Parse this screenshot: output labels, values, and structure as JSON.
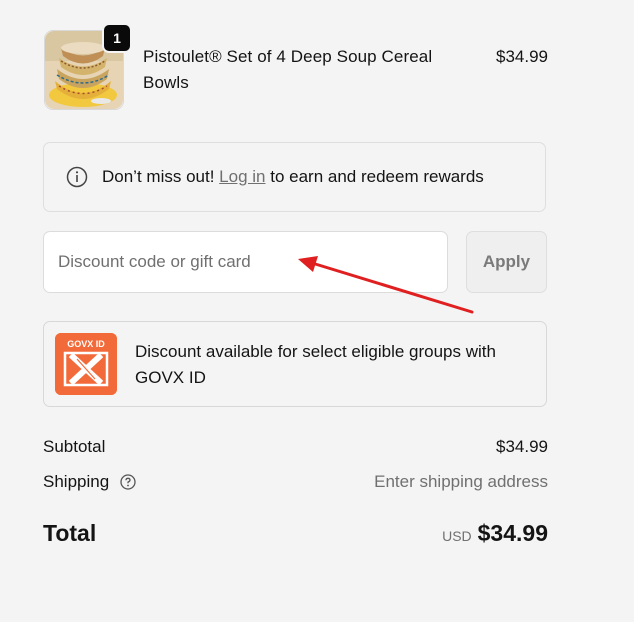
{
  "product": {
    "name": "Pistoulet® Set of 4 Deep Soup Cereal Bowls",
    "price": "$34.99",
    "quantity": "1",
    "image_icon": "bowls-product-image"
  },
  "rewards_banner": {
    "icon": "info-icon",
    "prefix": "Don’t miss out!",
    "link": "Log in",
    "suffix": "to earn and redeem rewards"
  },
  "discount": {
    "placeholder": "Discount code or gift card",
    "value": "",
    "apply_label": "Apply"
  },
  "govx": {
    "logo_text": "GOVX ID",
    "text": "Discount available for select eligible groups with GOVX ID",
    "brand_color": "#f26a3a"
  },
  "summary": {
    "subtotal_label": "Subtotal",
    "subtotal_value": "$34.99",
    "shipping_label": "Shipping",
    "shipping_value": "Enter shipping address",
    "total_label": "Total",
    "currency": "USD",
    "total_value": "$34.99"
  },
  "colors": {
    "background": "#f4f4f4",
    "annotation_arrow": "#e02020"
  }
}
